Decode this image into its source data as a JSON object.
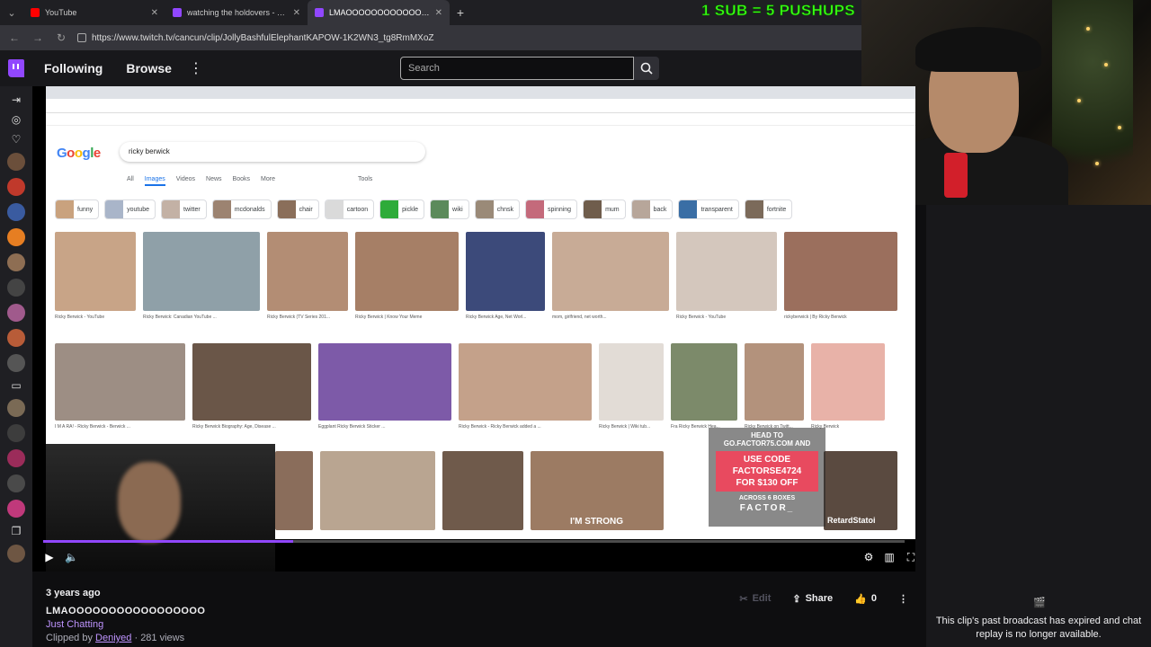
{
  "browser": {
    "tabs": [
      {
        "label": "YouTube",
        "icon_color": "#ff0000"
      },
      {
        "label": "watching the holdovers - Twitch",
        "icon_color": "#9147ff"
      },
      {
        "label": "LMAOOOOOOOOOOOOOOOOO",
        "icon_color": "#9147ff",
        "active": true
      }
    ],
    "url": "https://www.twitch.tv/cancun/clip/JollyBashfulElephantKAPOW-1K2WN3_tg8RmMXoZ"
  },
  "stream_overlay": {
    "text": "1 SUB = 5 PUSHUPS"
  },
  "twitch_nav": {
    "following": "Following",
    "browse": "Browse",
    "search_placeholder": "Search"
  },
  "google": {
    "logo": "Google",
    "query": "ricky berwick",
    "tabs": [
      "All",
      "Images",
      "Videos",
      "News",
      "Books",
      "More"
    ],
    "tools": "Tools",
    "chips": [
      "funny",
      "youtube",
      "twitter",
      "mcdonalds",
      "chair",
      "cartoon",
      "pickle",
      "wiki",
      "chnsk",
      "spinning",
      "mum",
      "back",
      "transparent",
      "fortnite"
    ],
    "row1_captions": [
      "Ricky Berwick - YouTube",
      "Ricky Berwick: Canadian YouTube ...",
      "Ricky Berwick (TV Series 201...",
      "Ricky Berwick | Know Your Meme",
      "Ricky Berwick Age, Net Worl...",
      "mom, girlfriend, net worth...",
      "Ricky Berwick - YouTube",
      "rickyberwick | By Ricky Berwick"
    ],
    "row2_captions": [
      "I M A RA! - Ricky Berwick - Berwick ...",
      "Ricky Berwick Biography: Age, Disease ...",
      "Eggplant Ricky Berwick Sticker ...",
      "Ricky Berwick - Ricky Berwick added a ...",
      "Ricky Berwick | Wiki tub...",
      "Fra Ricky Berwick Hea...",
      "Ricky Berwick on Twitt...",
      "Ricky Berwick"
    ],
    "strong_caption": "I'M STRONG",
    "retard_caption": "RetardStatoi"
  },
  "ad": {
    "line1": "HEAD TO",
    "line2": "GO.FACTOR75.COM AND",
    "code_line1": "USE CODE",
    "code_line2": "FACTORSE4724",
    "code_line3": "FOR $130 OFF",
    "line3": "ACROSS 6 BOXES",
    "brand": "FACTOR_"
  },
  "player": {
    "progress": 0.29
  },
  "clip": {
    "ago": "3 years ago",
    "title": "LMAOOOOOOOOOOOOOOOOO",
    "category": "Just Chatting",
    "clipped_by_prefix": "Clipped by",
    "clipper": "Deniyed",
    "views": "· 281 views",
    "edit": "Edit",
    "share": "Share",
    "likes": "0"
  },
  "chat": {
    "message": "This clip's past broadcast has expired and chat replay is no longer available."
  },
  "colors": {
    "twitch_purple": "#9147ff",
    "overlay_green": "#39ff14",
    "ad_red": "#e84a5f"
  }
}
